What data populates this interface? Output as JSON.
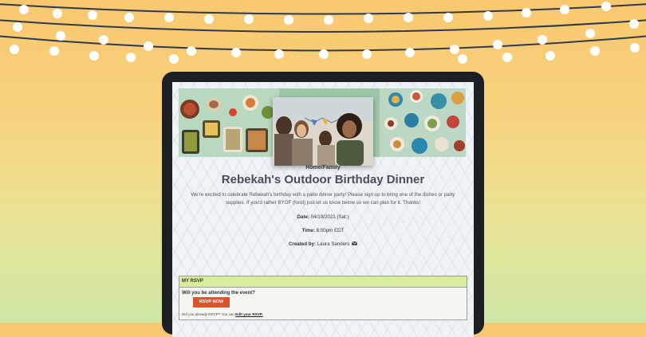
{
  "event": {
    "category": "Home/Family",
    "title": "Rebekah's Outdoor Birthday Dinner",
    "description": "We're excited to celebrate Rebekah's birthday with a patio dinner party! Please sign up to bring one of the dishes or party supplies. If you'd rather BYOF (food) just let us know below so we can plan for it. Thanks!",
    "date_label": "Date:",
    "date_value": "04/10/2021 (Sat.)",
    "time_label": "Time:",
    "time_value": "6:00pm EDT",
    "created_label": "Created by:",
    "created_value": "Laura Sanders",
    "creator_icon": "envelope-icon"
  },
  "rsvp": {
    "header": "MY RSVP",
    "question": "Will you be attending the event?",
    "button_label": "RSVP NOW",
    "note_text": "Did you already RSVP? You can",
    "note_link": "Edit your RSVP."
  },
  "colors": {
    "accent_button": "#d8552e",
    "rsvp_header_bg": "#d9ee9c",
    "title_text": "#4a4f55"
  }
}
